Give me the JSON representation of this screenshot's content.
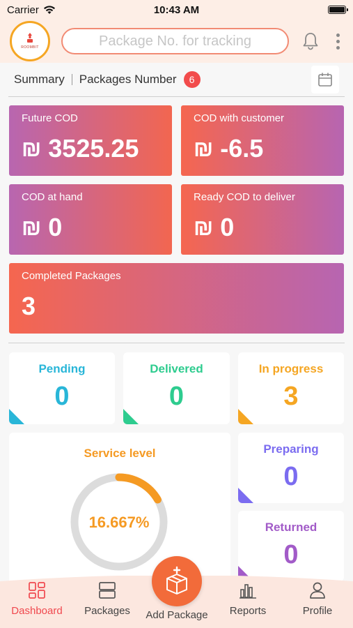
{
  "status_bar": {
    "carrier": "Carrier",
    "time": "10:43 AM"
  },
  "header": {
    "logo_text": "ROOMBIT",
    "search_placeholder": "Package No. for tracking"
  },
  "summary": {
    "label": "Summary",
    "packages_label": "Packages Number",
    "packages_count": "6"
  },
  "cod_cards": {
    "currency_symbol": "₪",
    "future_cod": {
      "title": "Future COD",
      "value": "3525.25"
    },
    "cod_with_customer": {
      "title": "COD with customer",
      "value": "-6.5"
    },
    "cod_at_hand": {
      "title": "COD at hand",
      "value": "0"
    },
    "ready_cod": {
      "title": "Ready COD to deliver",
      "value": "0"
    },
    "completed": {
      "title": "Completed Packages",
      "value": "3"
    }
  },
  "stats": {
    "pending": {
      "title": "Pending",
      "value": "0",
      "color": "#29b6d8"
    },
    "delivered": {
      "title": "Delivered",
      "value": "0",
      "color": "#2ecc8f"
    },
    "in_progress": {
      "title": "In progress",
      "value": "3",
      "color": "#f5a623"
    },
    "preparing": {
      "title": "Preparing",
      "value": "0",
      "color": "#7b6cf0"
    },
    "returned": {
      "title": "Returned",
      "value": "0",
      "color": "#a25bc8"
    }
  },
  "service_level": {
    "title": "Service level",
    "value_text": "16.667%",
    "fraction": 0.16667,
    "ring_color": "#f59a23",
    "track_color": "#dcdcdc"
  },
  "bottom_nav": {
    "dashboard": "Dashboard",
    "packages": "Packages",
    "add_package": "Add Package",
    "reports": "Reports",
    "profile": "Profile",
    "active_color": "#f0484e"
  }
}
